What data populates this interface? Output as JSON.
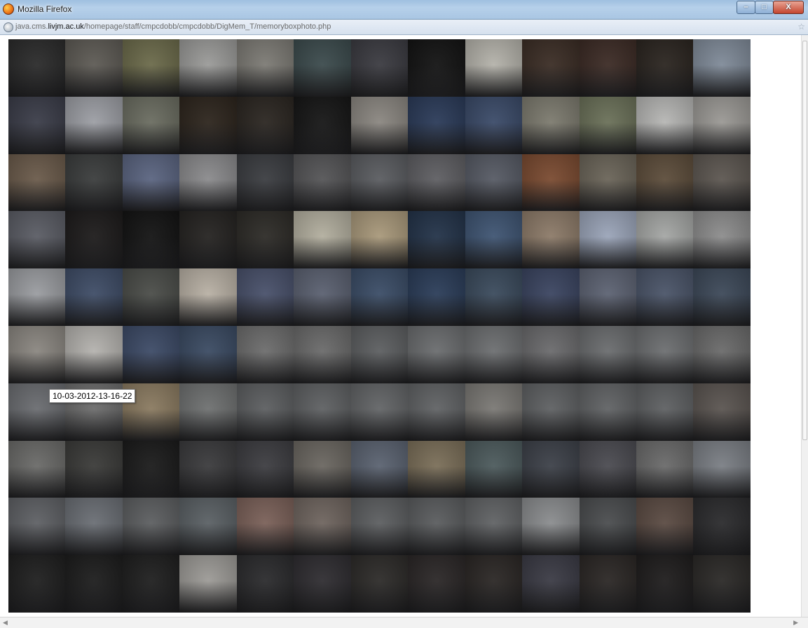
{
  "window": {
    "title": "Mozilla Firefox",
    "buttons": {
      "minimize": "–",
      "maximize": "□",
      "close": "X"
    }
  },
  "address_bar": {
    "url_prefix": "java.cms.",
    "url_domain": "livjm.ac.uk",
    "url_path": "/homepage/staff/cmpcdobb/cmpcdobb/DigMem_T/memoryboxphoto.php"
  },
  "tooltip": {
    "text": "10-03-2012-13-16-22"
  },
  "photo_grid": {
    "columns": 13,
    "rows": 10,
    "tile_colors": [
      [
        "#2a2a2a",
        "#5d5a54",
        "#6b6a4a",
        "#9a9a98",
        "#7c7a74",
        "#3b4a4c",
        "#3a3a40",
        "#121212",
        "#b4b2aa",
        "#3a2c24",
        "#3b2a24",
        "#2a241f",
        "#7f8a98"
      ],
      [
        "#3a3c48",
        "#9c9ea4",
        "#6a6c60",
        "#2c241c",
        "#2a2520",
        "#151515",
        "#8a8680",
        "#2a3a58",
        "#3a4a68",
        "#7c7a6e",
        "#6a7058",
        "#b6b6b4",
        "#9a9894"
      ],
      [
        "#6a5a4a",
        "#3a3c3c",
        "#5a6480",
        "#8a8a8c",
        "#3a3c40",
        "#545456",
        "#5a5c60",
        "#5e5e62",
        "#565a64",
        "#7a4a30",
        "#6a6458",
        "#5c4c3a",
        "#5c5650"
      ],
      [
        "#5a5c64",
        "#1c1a1a",
        "#121212",
        "#242220",
        "#2c2a26",
        "#b2ae9e",
        "#a8987a",
        "#223248",
        "#3e5472",
        "#8c7a68",
        "#9aa4b8",
        "#a4a6a4",
        "#8c8c8c"
      ],
      [
        "#9a9ca0",
        "#3e4c66",
        "#4a4c48",
        "#b8b0a4",
        "#48506a",
        "#5a6070",
        "#3a4c66",
        "#2a3c58",
        "#3a4a5c",
        "#3a4460",
        "#5c6272",
        "#4a5468",
        "#3c4858"
      ],
      [
        "#8a8680",
        "#b4b2ae",
        "#3c4a66",
        "#3a4a62",
        "#6c6c6c",
        "#6a6a6a",
        "#5c5e60",
        "#6a6c6e",
        "#6c6e70",
        "#6a6a6c",
        "#6a6c6e",
        "#6c6e70",
        "#6a6a6a"
      ],
      [
        "#6a6c70",
        "#6c6c6c",
        "#8a7a60",
        "#6e7070",
        "#5c5e60",
        "#5e6062",
        "#626466",
        "#606264",
        "#7a7874",
        "#5e6062",
        "#606264",
        "#5e6062",
        "#5a5450"
      ],
      [
        "#6a6a68",
        "#3a3a38",
        "#1a1a1a",
        "#3a3a3c",
        "#3c3c40",
        "#6a6660",
        "#5a6270",
        "#7a6e58",
        "#4c5a5c",
        "#3c4048",
        "#4a4a50",
        "#6a6a6a",
        "#7a7e84"
      ],
      [
        "#5e6064",
        "#6a6e74",
        "#5c5e60",
        "#5a6064",
        "#7a6058",
        "#6e645e",
        "#5c5e60",
        "#5a5c5e",
        "#606264",
        "#8a8c8e",
        "#4a4c4e",
        "#5a4a42",
        "#2a2a2c"
      ],
      [
        "#1e1e1e",
        "#1c1c1c",
        "#1e1e1e",
        "#9c9a96",
        "#2a2a2c",
        "#2e2c30",
        "#2c2a28",
        "#2a2626",
        "#2a2624",
        "#3a3a44",
        "#2a2624",
        "#1e1c1c",
        "#2a2826"
      ]
    ]
  }
}
